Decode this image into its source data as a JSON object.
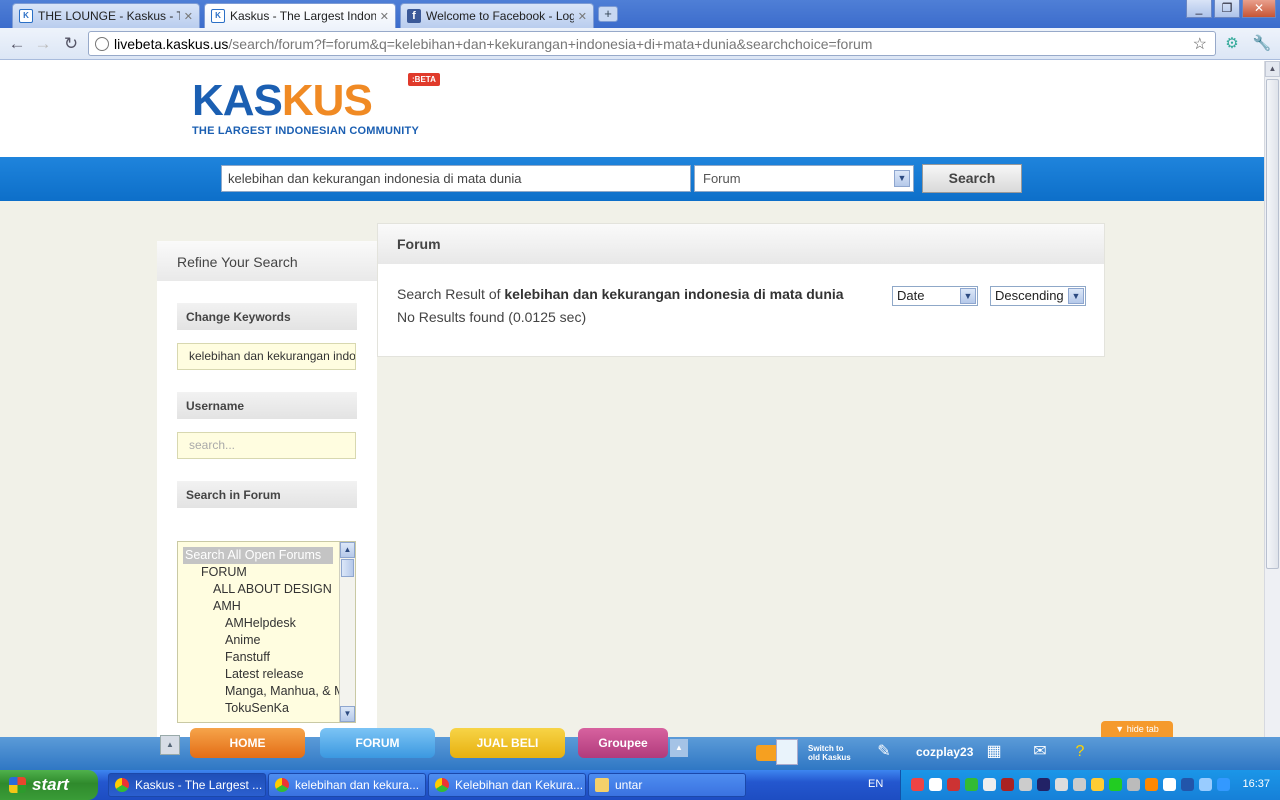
{
  "browser": {
    "tabs": [
      {
        "title": "THE LOUNGE - Kaskus - The La",
        "favicon": "kaskus-icon",
        "active": false
      },
      {
        "title": "Kaskus - The Largest Indonesi",
        "favicon": "kaskus-icon",
        "active": true
      },
      {
        "title": "Welcome to Facebook - Log In",
        "favicon": "facebook-icon",
        "active": false
      }
    ],
    "new_tab_label": "+",
    "url_host": "livebeta.kaskus.us",
    "url_path": "/search/forum?f=forum&q=kelebihan+dan+kekurangan+indonesia+di+mata+dunia&searchchoice=forum"
  },
  "site": {
    "logo_kas": "KAS",
    "logo_kus": "KUS",
    "logo_badge": ":BETA",
    "logo_tagline": "THE LARGEST INDONESIAN COMMUNITY",
    "search_value": "kelebihan dan kekurangan indonesia di mata dunia",
    "search_scope": "Forum",
    "search_button": "Search"
  },
  "sidebar": {
    "title": "Refine Your Search",
    "keywords_label": "Change Keywords",
    "keywords_value": "kelebihan dan kekurangan indonesia di mata dunia",
    "username_label": "Username",
    "username_placeholder": "search...",
    "forum_label": "Search in Forum",
    "forum_options": [
      {
        "label": "Search All Open Forums",
        "level": 0,
        "selected": true
      },
      {
        "label": "FORUM",
        "level": 1
      },
      {
        "label": "ALL ABOUT DESIGN",
        "level": 2
      },
      {
        "label": "AMH",
        "level": 2
      },
      {
        "label": "AMHelpdesk",
        "level": 3
      },
      {
        "label": "Anime",
        "level": 3
      },
      {
        "label": "Fanstuff",
        "level": 3
      },
      {
        "label": "Latest release",
        "level": 3
      },
      {
        "label": "Manga, Manhua, & Manhwa",
        "level": 3
      },
      {
        "label": "TokuSenKa",
        "level": 3
      }
    ]
  },
  "main": {
    "section_title": "Forum",
    "result_prefix": "Search Result of ",
    "result_query": "kelebihan dan kekurangan indonesia di mata dunia",
    "no_results": "No Results found (0.0125 sec)",
    "sort_field": "Date",
    "sort_order": "Descending"
  },
  "dock": {
    "tabs": [
      "HOME",
      "FORUM",
      "JUAL BELI",
      "Groupee"
    ],
    "switch_text_1": "Switch to",
    "switch_text_2": "old Kaskus",
    "username": "cozplay23",
    "hide_tab": "hide tab"
  },
  "taskbar": {
    "start": "start",
    "tasks": [
      "Kaskus - The Largest ...",
      "kelebihan dan kekura...",
      "Kelebihan dan Kekura...",
      "untar"
    ],
    "language": "EN",
    "clock": "16:37"
  },
  "colors": {
    "kaskus_blue": "#1b5fb2",
    "kaskus_orange": "#f08a24",
    "searchbar_blue": "#1478d4"
  }
}
